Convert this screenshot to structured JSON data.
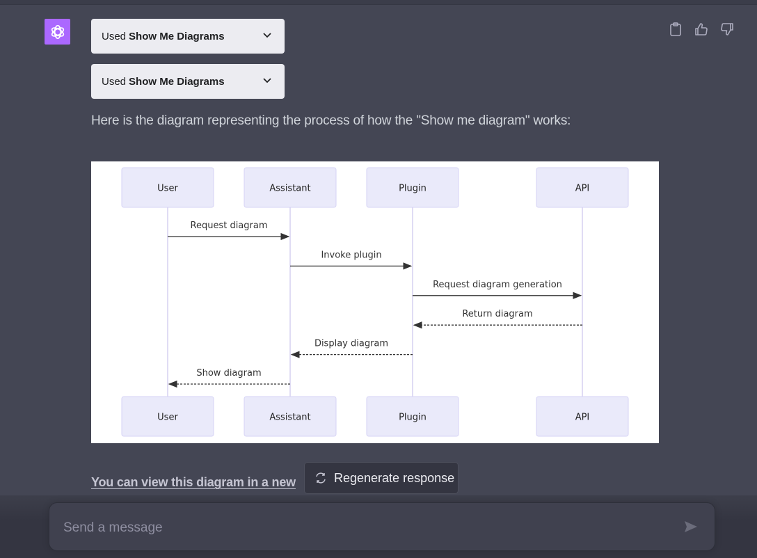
{
  "plugin_calls": [
    {
      "prefix": "Used",
      "name": "Show Me Diagrams"
    },
    {
      "prefix": "Used",
      "name": "Show Me Diagrams"
    }
  ],
  "message": {
    "intro": "Here is the diagram representing the process of how the \"Show me diagram\" works:",
    "link_text": "You can view this diagram in a new"
  },
  "actions": {
    "copy": "clipboard-icon",
    "like": "thumbs-up-icon",
    "dislike": "thumbs-down-icon"
  },
  "diagram": {
    "type": "sequence",
    "participants": [
      "User",
      "Assistant",
      "Plugin",
      "API"
    ],
    "messages": [
      {
        "from": "User",
        "to": "Assistant",
        "label": "Request diagram",
        "style": "solid"
      },
      {
        "from": "Assistant",
        "to": "Plugin",
        "label": "Invoke plugin",
        "style": "solid"
      },
      {
        "from": "Plugin",
        "to": "API",
        "label": "Request diagram generation",
        "style": "solid"
      },
      {
        "from": "API",
        "to": "Plugin",
        "label": "Return diagram",
        "style": "dashed"
      },
      {
        "from": "Plugin",
        "to": "Assistant",
        "label": "Display diagram",
        "style": "dashed"
      },
      {
        "from": "Assistant",
        "to": "User",
        "label": "Show diagram",
        "style": "dashed"
      }
    ],
    "colors": {
      "actor_fill": "#eaeafa",
      "actor_stroke": "#d6d3f5",
      "lifeline": "#d6d0f0",
      "arrow": "#333333"
    }
  },
  "regenerate": {
    "label": "Regenerate response"
  },
  "composer": {
    "placeholder": "Send a message"
  },
  "colors": {
    "avatar": "#ab68ff",
    "background": "#444654"
  }
}
